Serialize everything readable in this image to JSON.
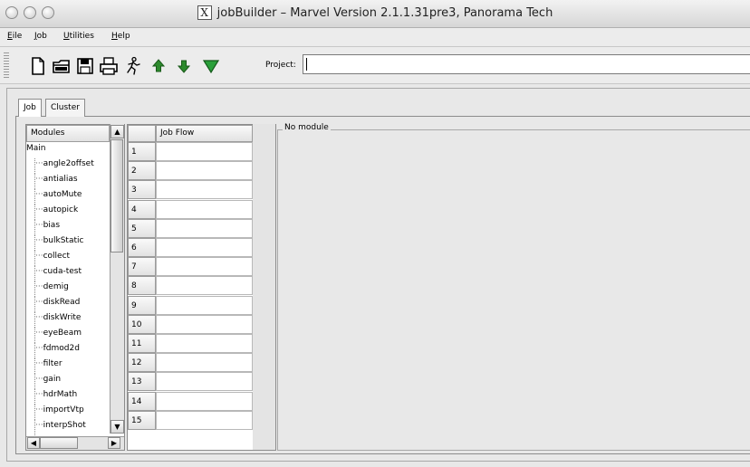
{
  "window": {
    "title_icon": "X",
    "title": "jobBuilder – Marvel Version 2.1.1.31pre3, Panorama Tech"
  },
  "menubar": [
    {
      "key": "E",
      "rest": "ile"
    },
    {
      "key": "J",
      "rest": "ob"
    },
    {
      "key": "U",
      "rest": "tilities"
    },
    {
      "key": "H",
      "rest": "elp"
    }
  ],
  "toolbar": {
    "icons": [
      "new-file-icon",
      "open-icon",
      "save-icon",
      "print-icon",
      "run-icon",
      "move-up-icon",
      "move-down-icon",
      "filter-icon"
    ],
    "project_label": "Project:",
    "project_value": ""
  },
  "tabs": [
    {
      "label": "Job",
      "active": true
    },
    {
      "label": "Cluster",
      "active": false
    }
  ],
  "modules": {
    "header": "Modules",
    "root": "Main",
    "items": [
      "angle2offset",
      "antialias",
      "autoMute",
      "autopick",
      "bias",
      "bulkStatic",
      "collect",
      "cuda-test",
      "demig",
      "diskRead",
      "diskWrite",
      "eyeBeam",
      "fdmod2d",
      "filter",
      "gain",
      "hdrMath",
      "importVtp",
      "interpShot"
    ]
  },
  "jobflow": {
    "header": "Job Flow",
    "rows": [
      "1",
      "2",
      "3",
      "4",
      "5",
      "6",
      "7",
      "8",
      "9",
      "10",
      "11",
      "12",
      "13",
      "14",
      "15"
    ]
  },
  "detail": {
    "label": "No module"
  },
  "colors": {
    "window_bg": "#e8e8e8",
    "panel_bg": "#ffffff",
    "border": "#8c8c8c",
    "up_arrow": "#2d8a2d",
    "down_arrow": "#2d8a2d"
  }
}
